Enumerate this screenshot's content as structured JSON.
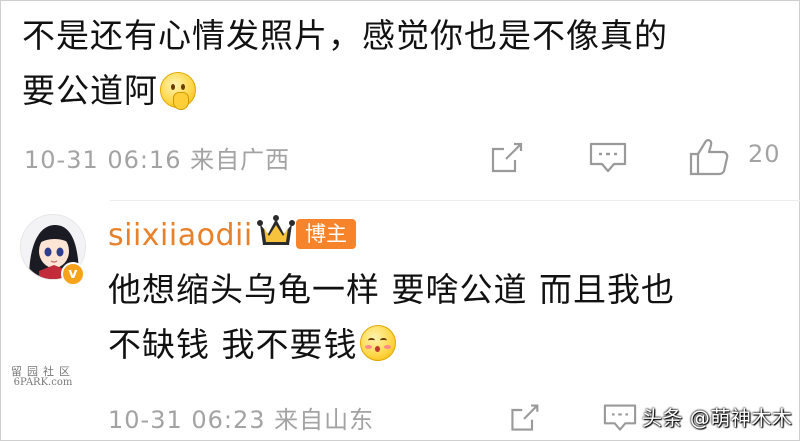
{
  "comments": [
    {
      "text_line1": "不是还有心情发照片，感觉你也是不像真的",
      "text_line2": "要公道阿",
      "emoji": "thinking-emoji",
      "time": "10-31 06:16",
      "location": "来自广西",
      "likes": "20"
    },
    {
      "username": "siixiiaodii",
      "badge": "博主",
      "verified_mark": "v",
      "text_line1": "他想缩头乌龟一样 要啥公道 而且我也",
      "text_line2": "不缺钱 我不要钱",
      "emoji": "blush-kiss-emoji",
      "time": "10-31 06:23",
      "location": "来自山东"
    }
  ],
  "watermarks": {
    "site_name": "留园社区",
    "site_domain": "6PARK.com",
    "toutiao": "头条 @萌神木木"
  },
  "colors": {
    "username": "#e8812a",
    "badge_bg": "#f7842b",
    "meta_text": "#a3a3a3",
    "verified": "#f6a21a"
  }
}
